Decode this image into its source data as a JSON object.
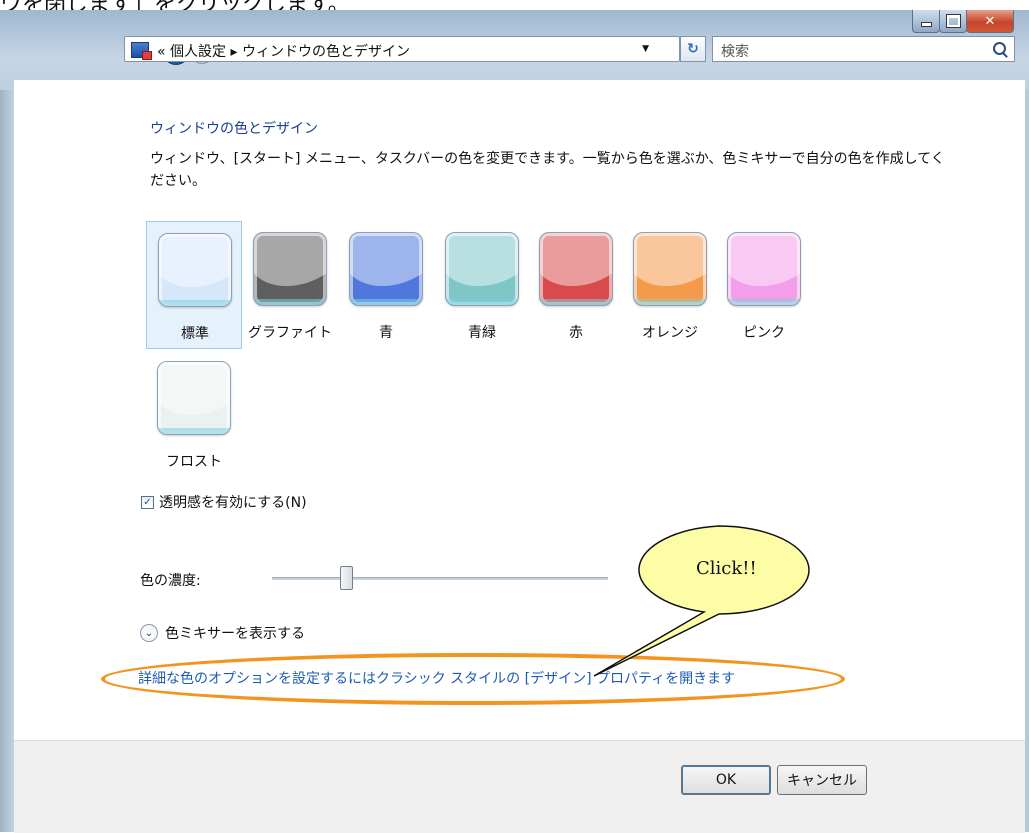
{
  "caption": "ウを閉じます」をクリックします。",
  "address": {
    "path": "« 個人設定 ▸ ウィンドウの色とデザイン",
    "search_placeholder": "検索"
  },
  "main": {
    "title": "ウィンドウの色とデザイン",
    "description": "ウィンドウ、[スタート] メニュー、タスクバーの色を変更できます。一覧から色を選ぶか、色ミキサーで自分の色を作成してください。",
    "swatches": [
      {
        "label": "標準",
        "color": "#d6e6fb",
        "selected": true
      },
      {
        "label": "グラファイト",
        "color": "#5f5f5f",
        "selected": false
      },
      {
        "label": "青",
        "color": "#4f77dd",
        "selected": false
      },
      {
        "label": "青緑",
        "color": "#7fc6c9",
        "selected": false
      },
      {
        "label": "赤",
        "color": "#d94a4a",
        "selected": false
      },
      {
        "label": "オレンジ",
        "color": "#f59a4a",
        "selected": false
      },
      {
        "label": "ピンク",
        "color": "#f39ee9",
        "selected": false
      },
      {
        "label": "フロスト",
        "color": "#e9f2f0",
        "selected": false
      }
    ],
    "transparency_label": "透明感を有効にする(N)",
    "transparency_checked": true,
    "intensity_label": "色の濃度:",
    "intensity_value": 0.22,
    "mixer_label": "色ミキサーを表示する",
    "advanced_link": "詳細な色のオプションを設定するにはクラシック スタイルの [デザイン] プロパティを開きます"
  },
  "callout": {
    "text": "Click!!"
  },
  "buttons": {
    "ok": "OK",
    "cancel": "キャンセル"
  }
}
